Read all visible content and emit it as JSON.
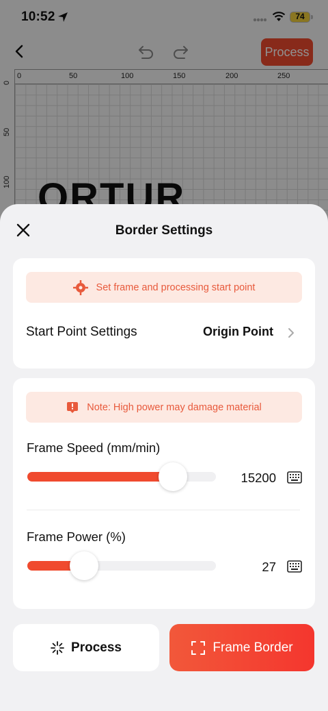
{
  "status_bar": {
    "time": "10:52",
    "battery": "74"
  },
  "toolbar": {
    "process_label": "Process"
  },
  "ruler": {
    "top_ticks": [
      "0",
      "50",
      "100",
      "150",
      "200",
      "250"
    ],
    "left_ticks": [
      "0",
      "50",
      "100"
    ]
  },
  "canvas": {
    "text": "ORTUR"
  },
  "sheet": {
    "title": "Border Settings",
    "start_card": {
      "notice": "Set frame and processing start point",
      "label": "Start Point Settings",
      "value": "Origin Point"
    },
    "power_card": {
      "notice": "Note: High power may damage material",
      "speed": {
        "label": "Frame Speed (mm/min)",
        "value": "15200",
        "fraction": 0.771
      },
      "power": {
        "label": "Frame Power (%)",
        "value": "27",
        "fraction": 0.3
      }
    },
    "buttons": {
      "process": "Process",
      "frame_border": "Frame Border"
    }
  },
  "colors": {
    "accent": "#f04a2e",
    "notice_bg": "#fde9e2",
    "notice_text": "#e85a3c"
  }
}
